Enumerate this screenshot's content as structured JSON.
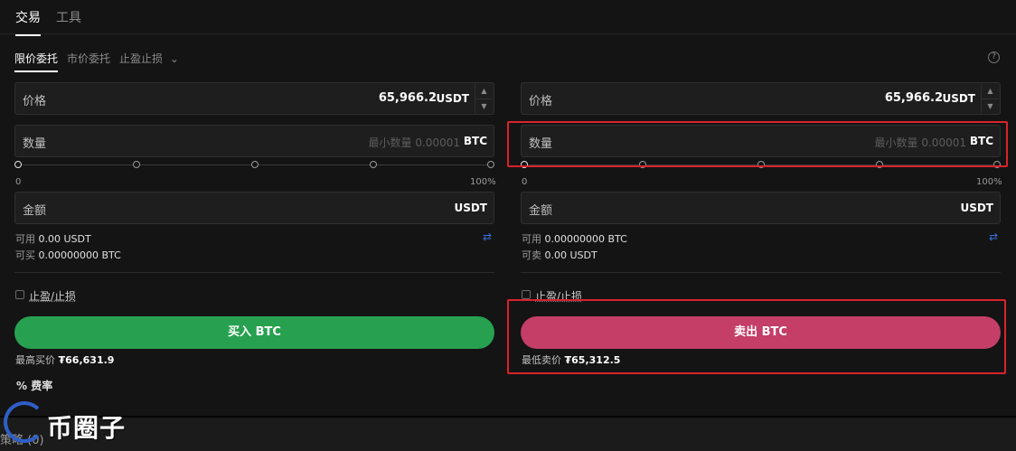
{
  "top_tabs": [
    "交易",
    "工具"
  ],
  "order_tabs": {
    "limit": "限价委托",
    "market": "市价委托",
    "tpsl": "止盈止损",
    "tpsl_chevron": "⌄"
  },
  "help_icon": "?",
  "buy": {
    "price_label": "价格",
    "price_value": "65,966.2",
    "price_unit": "USDT",
    "qty_label": "数量",
    "qty_placeholder": "最小数量 0.00001",
    "qty_unit": "BTC",
    "slider_min": "0",
    "slider_max": "100%",
    "slider_level": 0,
    "amount_label": "金额",
    "amount_unit": "USDT",
    "available_label": "可用",
    "available_value": "0.00 USDT",
    "can_label": "可买",
    "can_value": "0.00000000 BTC",
    "tpsl_label": "止盈/止损",
    "button": "买入 BTC",
    "best_label": "最高买价",
    "best_value": "₮66,631.9"
  },
  "sell": {
    "price_label": "价格",
    "price_value": "65,966.2",
    "price_unit": "USDT",
    "qty_label": "数量",
    "qty_placeholder": "最小数量 0.00001",
    "qty_unit": "BTC",
    "slider_min": "0",
    "slider_max": "100%",
    "slider_level": 0,
    "amount_label": "金额",
    "amount_unit": "USDT",
    "available_label": "可用",
    "available_value": "0.00000000 BTC",
    "can_label": "可卖",
    "can_value": "0.00 USDT",
    "tpsl_label": "止盈/止损",
    "button": "卖出 BTC",
    "best_label": "最低卖价",
    "best_value": "₮65,312.5"
  },
  "fee_label": "% 费率",
  "bottom": {
    "strategy": "策略 (0)"
  },
  "watermark": "币圈子",
  "icons": {
    "swap": "swap-icon",
    "stepper_up": "▲",
    "stepper_down": "▼"
  },
  "colors": {
    "buy": "#27a150",
    "sell": "#c43e67",
    "highlight": "#d9232a",
    "link": "#3b6fd8"
  }
}
